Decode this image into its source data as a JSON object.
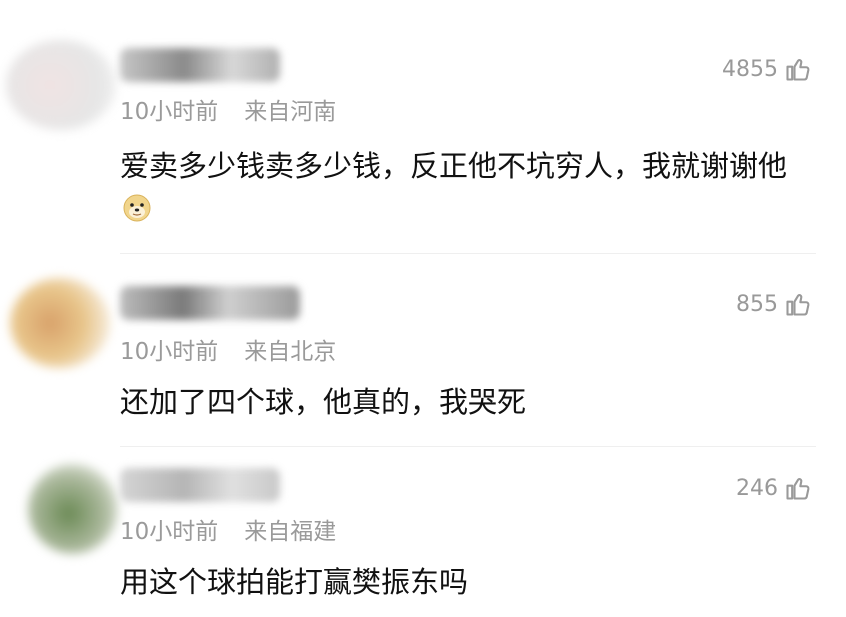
{
  "comments": [
    {
      "time": "10小时前",
      "location": "来自河南",
      "likes": "4855",
      "text": "爱卖多少钱卖多少钱，反正他不坑穷人，我就谢谢他",
      "emoji": "doge-emoji-icon"
    },
    {
      "time": "10小时前",
      "location": "来自北京",
      "likes": "855",
      "text": "还加了四个球，他真的，我哭死"
    },
    {
      "time": "10小时前",
      "location": "来自福建",
      "likes": "246",
      "text": "用这个球拍能打赢樊振东吗"
    }
  ],
  "colors": {
    "meta": "#9a9a9a",
    "text": "#111111",
    "likes": "#999999"
  }
}
